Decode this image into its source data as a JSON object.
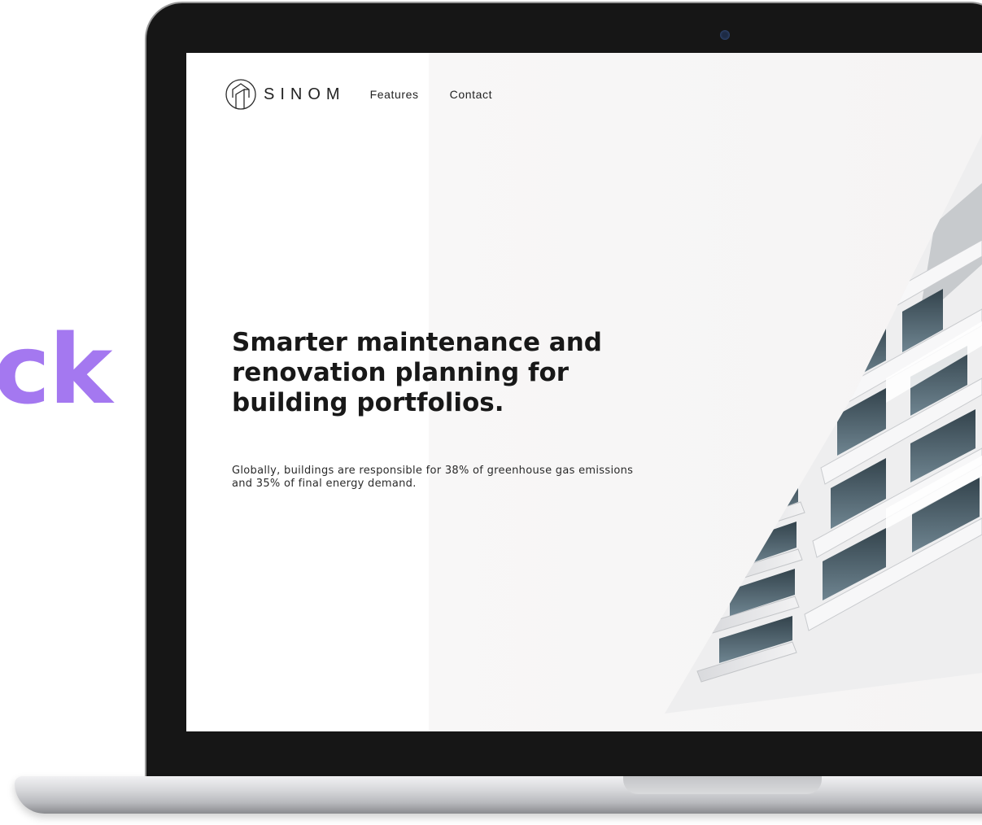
{
  "backdrop": {
    "partial_word": "ck",
    "accent_color": "#a478f0"
  },
  "site": {
    "brand": "SINOM",
    "logo_icon": "house-outline-icon",
    "nav": [
      {
        "label": "Features"
      },
      {
        "label": "Contact"
      }
    ]
  },
  "hero": {
    "title": "Smarter maintenance and renovation planning for building portfolios.",
    "subtitle": "Globally, buildings are responsible for 38% of greenhouse gas emissions and 35% of final energy demand."
  }
}
